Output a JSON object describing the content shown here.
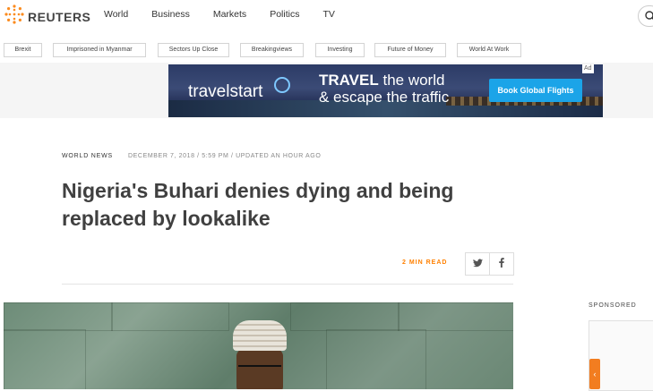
{
  "brand": {
    "name": "REUTERS"
  },
  "nav": {
    "items": [
      "World",
      "Business",
      "Markets",
      "Politics",
      "TV"
    ]
  },
  "tags": [
    "Brexit",
    "Imprisoned in Myanmar",
    "Sectors Up Close",
    "Breakingviews",
    "Investing",
    "Future of Money",
    "World At Work"
  ],
  "ad": {
    "brand": "travelstart",
    "headline_1_strong": "TRAVEL",
    "headline_1_rest": " the world",
    "headline_2": "& escape the traffic",
    "cta": "Book Global Flights",
    "badge": "Ad"
  },
  "article": {
    "kicker": "WORLD NEWS",
    "dateline": "DECEMBER 7, 2018 / 5:59 PM / UPDATED AN HOUR AGO",
    "headline": "Nigeria's Buhari denies dying and being replaced by lookalike",
    "read_time": "2 MIN READ"
  },
  "sidebar": {
    "sponsored_label": "SPONSORED"
  },
  "colors": {
    "accent": "#ff8000",
    "reuters_orange": "#fb8b1e",
    "ad_cta": "#1ba4e8"
  },
  "icons": [
    "reuters-logo-icon",
    "search-icon",
    "twitter-icon",
    "facebook-icon",
    "chevron-left-icon"
  ]
}
